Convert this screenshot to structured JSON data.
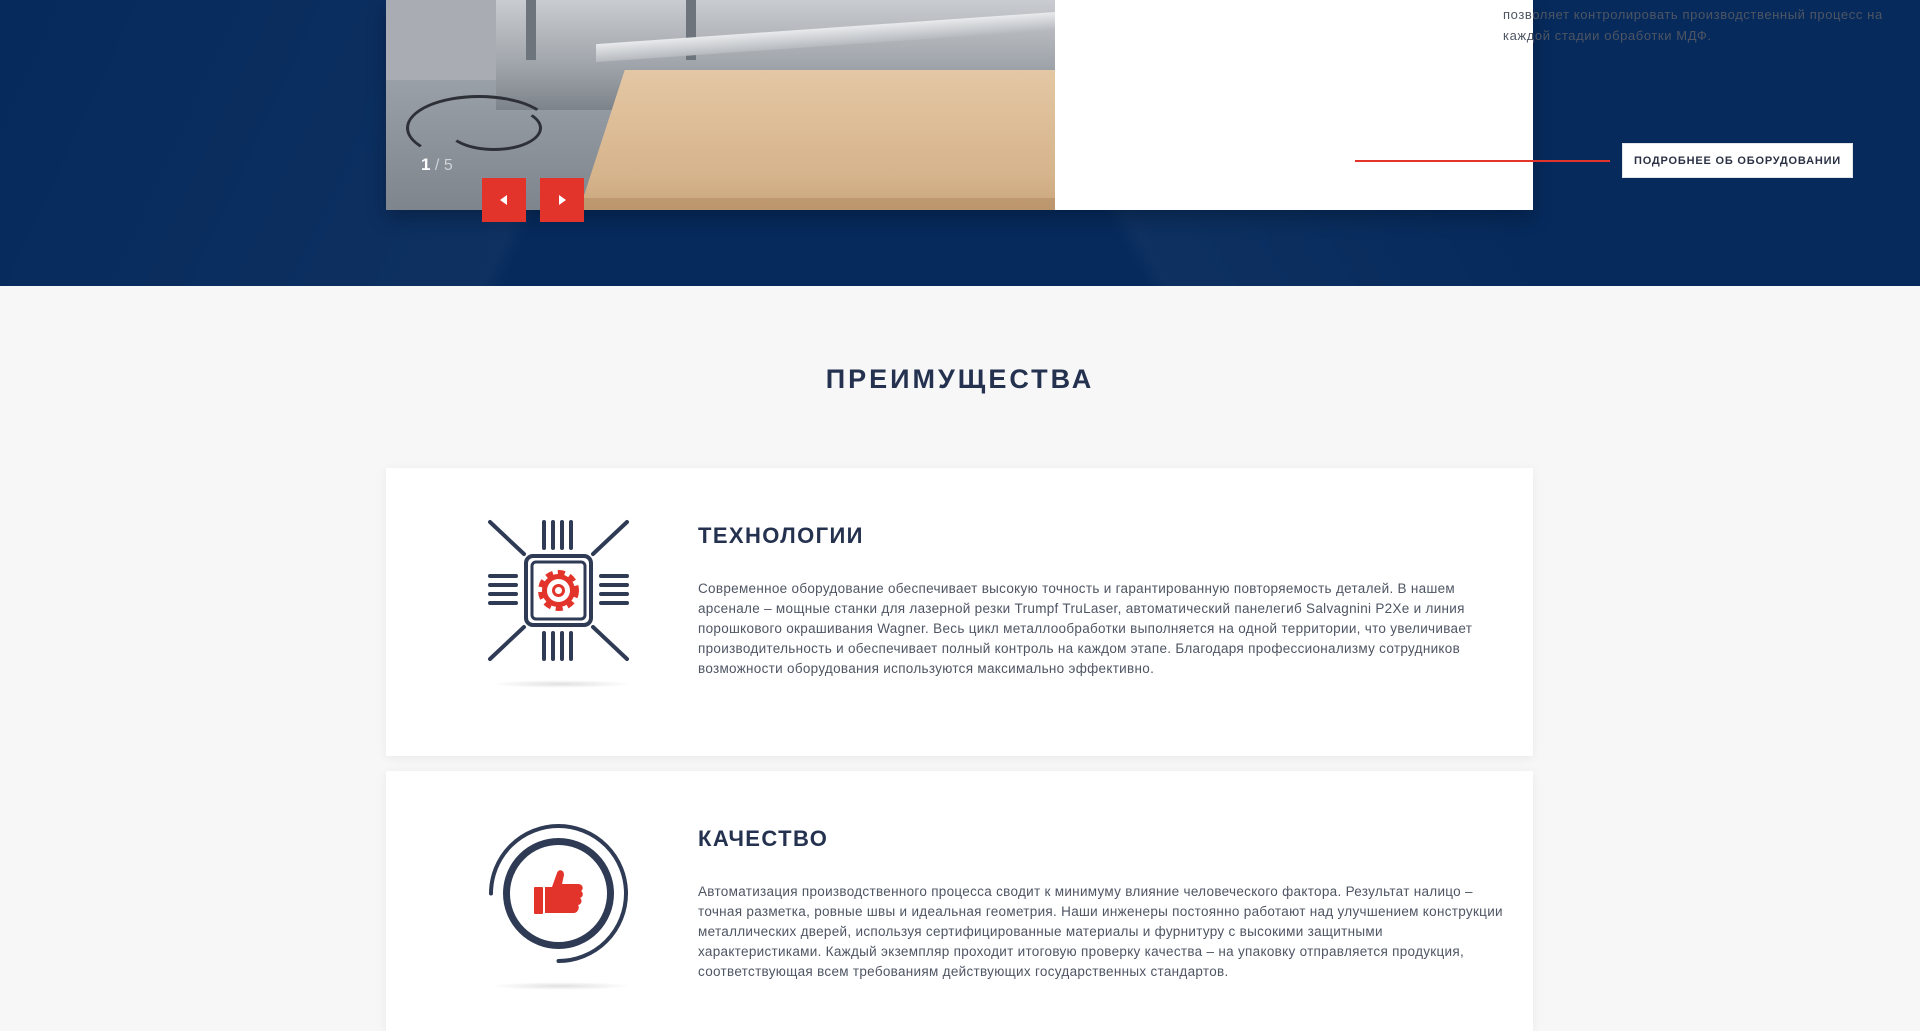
{
  "slider": {
    "current": "1",
    "separator_total": "/ 5",
    "description": "позволяет контролировать производственный процесс на каждой стадии обработки МДФ.",
    "more_button": "ПОДРОБНЕЕ ОБ ОБОРУДОВАНИИ",
    "prev_icon": "arrow-left-icon",
    "next_icon": "arrow-right-icon"
  },
  "advantages": {
    "title": "ПРЕИМУЩЕСТВА",
    "items": [
      {
        "icon": "chip-gear-icon",
        "title": "ТЕХНОЛОГИИ",
        "text": "Современное оборудование обеспечивает высокую точность и гарантированную повторяемость деталей. В нашем арсенале – мощные станки для лазерной резки Trumpf TruLaser, автоматический панелегиб Salvagnini P2Xe и линия порошкового окрашивания Wagner. Весь цикл металлообработки выполняется на одной территории, что увеличивает производительность и обеспечивает полный контроль на каждом этапе. Благодаря профессионализму сотрудников возможности оборудования используются максимально эффективно."
      },
      {
        "icon": "thumbs-up-icon",
        "title": "КАЧЕСТВО",
        "text": "Автоматизация производственного процесса сводит к минимуму влияние человеческого фактора. Результат налицо – точная разметка, ровные швы и идеальная геометрия. Наши инженеры постоянно работают над улучшением конструкции металлических дверей, используя сертифицированные материалы и фурнитуру с высокими защитными характеристиками. Каждый экземпляр проходит итоговую проверку качества – на упаковку отправляется продукция, соответствующая всем требованиям действующих государственных стандартов."
      }
    ]
  },
  "colors": {
    "accent": "#e3342b",
    "navy": "#062a5c",
    "heading": "#24324f"
  }
}
